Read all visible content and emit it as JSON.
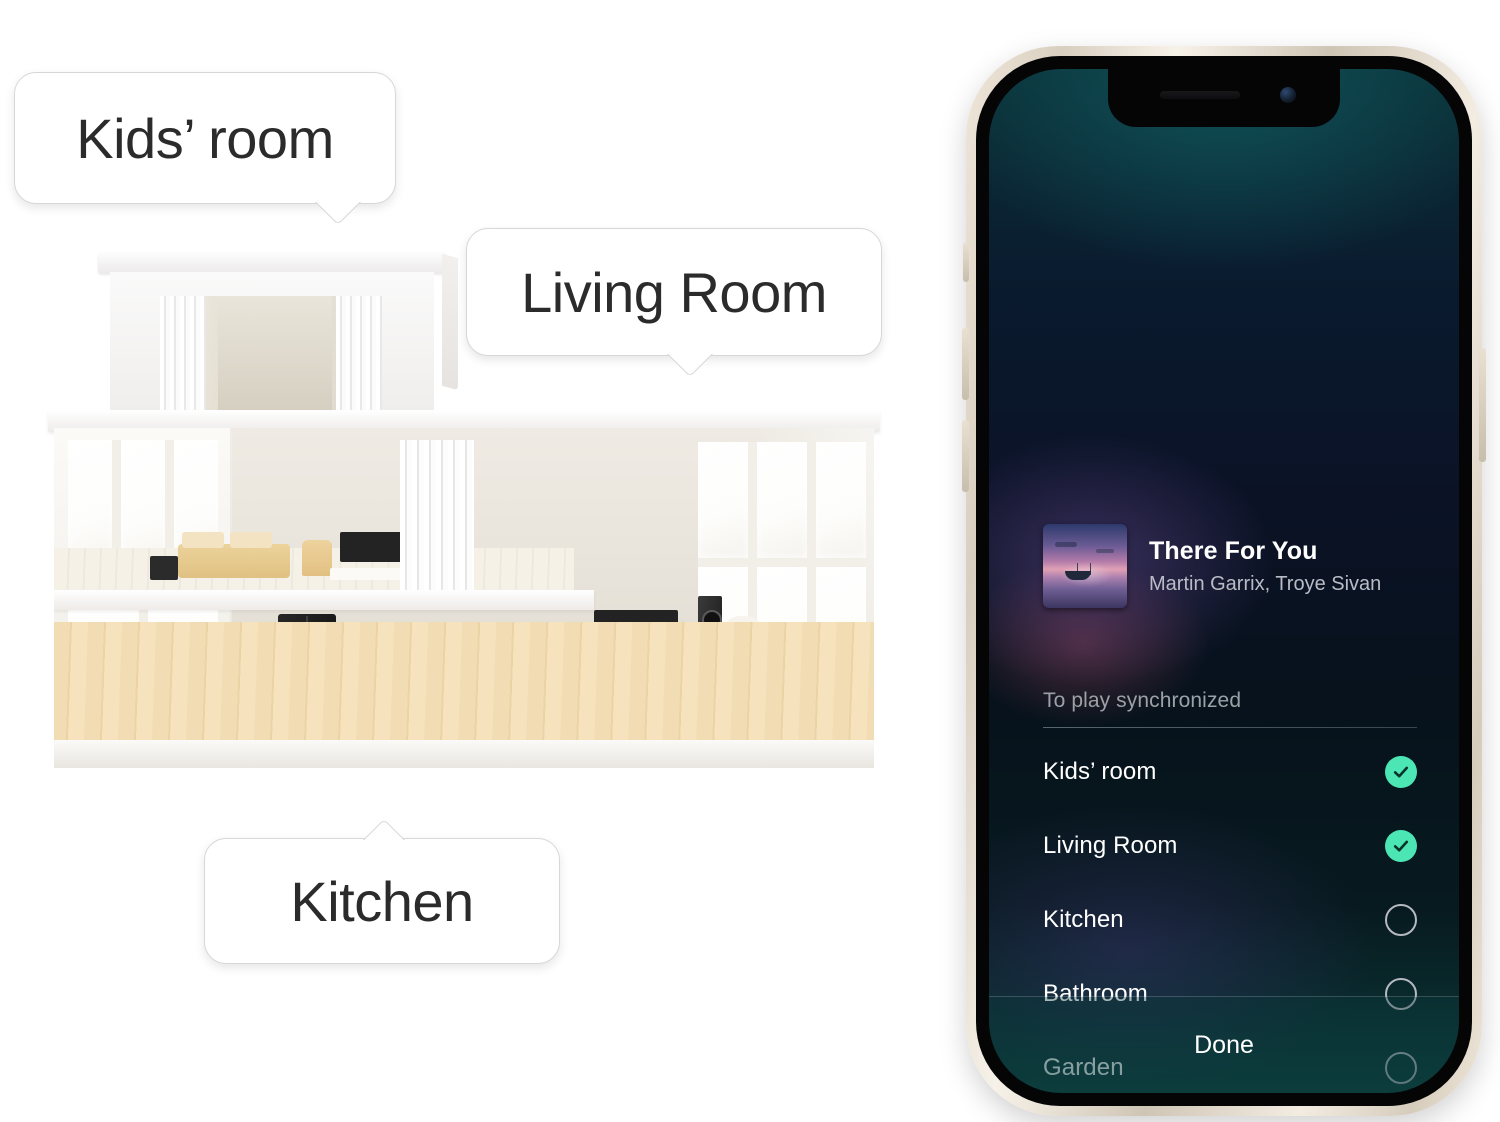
{
  "callouts": [
    {
      "id": "kids",
      "label": "Kids’ room",
      "tail": "down"
    },
    {
      "id": "living",
      "label": "Living Room",
      "tail": "down"
    },
    {
      "id": "kitchen",
      "label": "Kitchen",
      "tail": "up"
    }
  ],
  "phone": {
    "now_playing": {
      "title": "There For You",
      "artist": "Martin Garrix, Troye Sivan",
      "artwork_alt": "boat-on-water-at-sunset"
    },
    "section_label": "To play synchronized",
    "rooms": [
      {
        "name": "Kids’ room",
        "selected": true
      },
      {
        "name": "Living Room",
        "selected": true
      },
      {
        "name": "Kitchen",
        "selected": false
      },
      {
        "name": "Bathroom",
        "selected": false
      },
      {
        "name": "Garden",
        "selected": false
      }
    ],
    "done_label": "Done",
    "colors": {
      "accent_check": "#4ce6b4",
      "toggle_off_border": "#b6b9c0",
      "text_primary": "#ffffff",
      "text_secondary": "#b9bcc6",
      "section_label": "#9aa2a6",
      "screen_top": "#0b3138",
      "screen_bottom": "#0b3a3a",
      "frame": "#e4dacb"
    }
  },
  "illustration": {
    "alt": "cutaway-dollhouse-two-storey-home",
    "rooms_shown": [
      "Kids’ room",
      "Living Room",
      "Kitchen"
    ]
  }
}
